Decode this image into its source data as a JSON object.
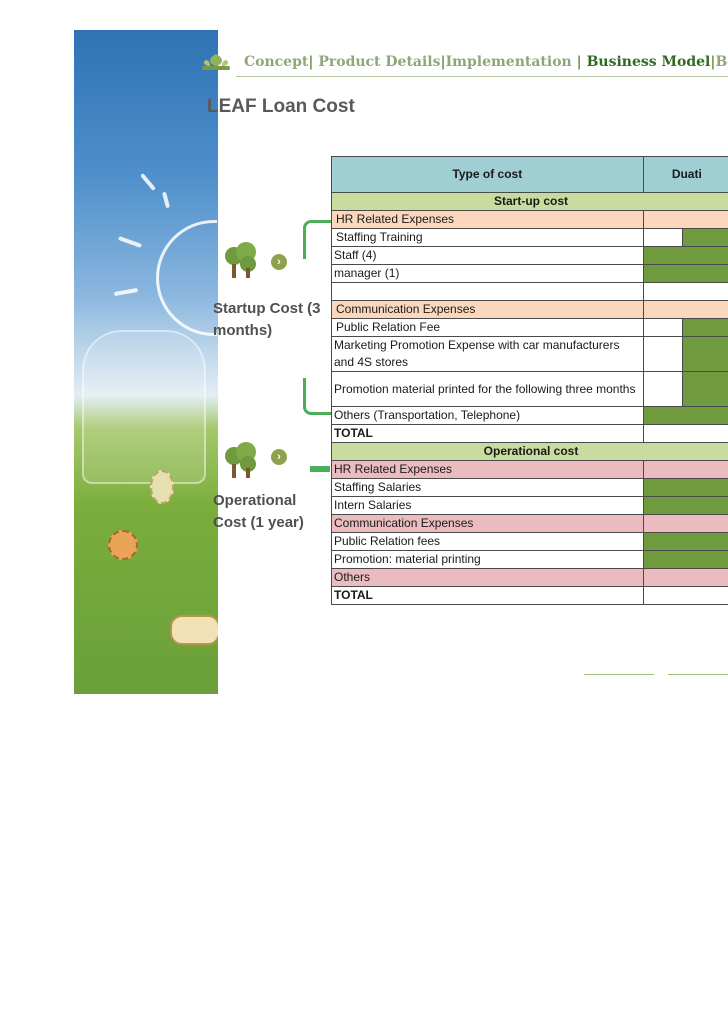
{
  "nav": {
    "items": [
      {
        "label": "Concept",
        "active": false
      },
      {
        "label": "Product Details",
        "active": false
      },
      {
        "label": "Implementation",
        "active": false
      },
      {
        "label": "Business Model",
        "active": true
      },
      {
        "label": "Ber",
        "active": false
      }
    ],
    "separator": "|"
  },
  "page_title": "LEAF Loan Cost",
  "side_labels": {
    "startup": "Startup Cost (3 months)",
    "operational": "Operational Cost (1 year)"
  },
  "table": {
    "headers": {
      "type": "Type of cost",
      "duration": "Duati"
    },
    "startup_section": "Start-up cost",
    "operational_section": "Operational cost",
    "startup_rows": [
      {
        "label": "HR Related Expenses",
        "kind": "category"
      },
      {
        "label": "Staffing Training",
        "kind": "item"
      },
      {
        "label": "Staff (4)",
        "kind": "item"
      },
      {
        "label": "manager (1)",
        "kind": "item"
      },
      {
        "label": "",
        "kind": "blank"
      },
      {
        "label": "Communication Expenses",
        "kind": "category"
      },
      {
        "label": "Public Relation Fee",
        "kind": "item"
      },
      {
        "label": "Marketing Promotion Expense with car manufacturers and 4S stores",
        "kind": "item"
      },
      {
        "label": "Promotion material printed for the following three months",
        "kind": "item"
      },
      {
        "label": "Others (Transportation, Telephone)",
        "kind": "item"
      },
      {
        "label": "TOTAL",
        "kind": "total"
      }
    ],
    "operational_rows": [
      {
        "label": "HR Related Expenses",
        "kind": "category"
      },
      {
        "label": "Staffing Salaries",
        "kind": "item"
      },
      {
        "label": "Intern Salaries",
        "kind": "item"
      },
      {
        "label": "Communication Expenses",
        "kind": "category"
      },
      {
        "label": "Public Relation fees",
        "kind": "item"
      },
      {
        "label": "Promotion: material printing",
        "kind": "item"
      },
      {
        "label": "Others",
        "kind": "category"
      },
      {
        "label": "TOTAL",
        "kind": "total"
      }
    ]
  },
  "colors": {
    "header_bg": "#9fcfd3",
    "section_bg": "#c8dc9f",
    "startup_category_bg": "#fbd8bd",
    "operational_category_bg": "#ebbcbf",
    "filled_cell": "#6f9a3e",
    "bracket": "#4caf58",
    "active_nav": "#2f6b20"
  },
  "icons": [
    "leaf-logo-icon",
    "tree-icon",
    "arrow-right-icon"
  ]
}
